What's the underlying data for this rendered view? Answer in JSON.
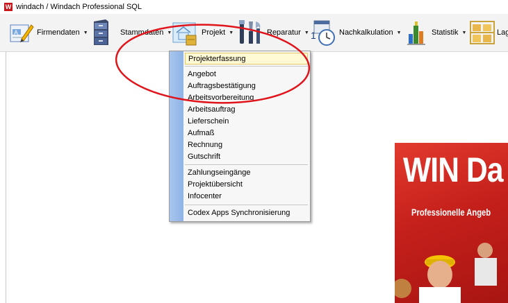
{
  "window": {
    "title": "windach / Windach Professional SQL",
    "app_icon": "W"
  },
  "toolbar": {
    "items": [
      {
        "label": "Firmendaten",
        "icon": "pencil-form-icon"
      },
      {
        "label": "Stammdaten",
        "icon": "filing-cabinet-icon"
      },
      {
        "label": "Projekt",
        "icon": "house-blueprint-icon"
      },
      {
        "label": "Reparatur",
        "icon": "tools-icon"
      },
      {
        "label": "Nachkalkulation",
        "icon": "calendar-clock-icon"
      },
      {
        "label": "Statistik",
        "icon": "bar-chart-icon"
      },
      {
        "label": "Lag",
        "icon": "shelf-boxes-icon"
      }
    ]
  },
  "menu": {
    "items": [
      {
        "label": "Projekterfassung",
        "highlighted": true
      },
      {
        "label": "Angebot"
      },
      {
        "label": "Auftragsbestätigung"
      },
      {
        "label": "Arbeitsvorbereitung"
      },
      {
        "label": "Arbeitsauftrag"
      },
      {
        "label": "Lieferschein"
      },
      {
        "label": "Aufmaß"
      },
      {
        "label": "Rechnung"
      },
      {
        "label": "Gutschrift"
      },
      {
        "label": "Zahlungseingänge"
      },
      {
        "label": "Projektübersicht"
      },
      {
        "label": "Infocenter"
      },
      {
        "label": "Codex Apps Synchronisierung"
      }
    ]
  },
  "banner": {
    "title": "WIN Da",
    "subtitle": "Professionelle Angeb"
  },
  "colors": {
    "accent_red": "#c8171b",
    "highlight": "#fff9d4",
    "menu_strip": "#a8c6ee",
    "annotation": "#e0141b"
  }
}
